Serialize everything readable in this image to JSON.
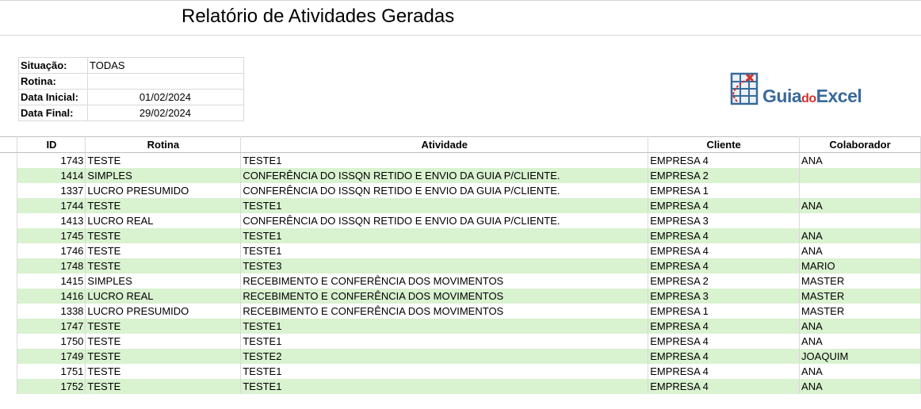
{
  "title": "Relatório de Atividades Geradas",
  "filters": [
    {
      "label": "Situação:",
      "value": "TODAS",
      "align": "left"
    },
    {
      "label": "Rotina:",
      "value": "",
      "align": "left"
    },
    {
      "label": "Data Inicial:",
      "value": "01/02/2024",
      "align": "right"
    },
    {
      "label": "Data Final:",
      "value": "29/02/2024",
      "align": "right"
    }
  ],
  "logo": {
    "part1": "Guia",
    "part2": "do",
    "part3": "Excel",
    "icon": "spreadsheet-logo-icon"
  },
  "table": {
    "headers": [
      "ID",
      "Rotina",
      "Atividade",
      "Cliente",
      "Colaborador"
    ],
    "rows": [
      [
        "1743",
        "TESTE",
        "TESTE1",
        "EMPRESA 4",
        "ANA"
      ],
      [
        "1414",
        "SIMPLES",
        "CONFERÊNCIA DO ISSQN RETIDO E ENVIO DA GUIA P/CLIENTE.",
        "EMPRESA 2",
        ""
      ],
      [
        "1337",
        "LUCRO PRESUMIDO",
        "CONFERÊNCIA DO ISSQN RETIDO E ENVIO DA GUIA P/CLIENTE.",
        "EMPRESA 1",
        ""
      ],
      [
        "1744",
        "TESTE",
        "TESTE1",
        "EMPRESA 4",
        "ANA"
      ],
      [
        "1413",
        "LUCRO REAL",
        "CONFERÊNCIA DO ISSQN RETIDO E ENVIO DA GUIA P/CLIENTE.",
        "EMPRESA 3",
        ""
      ],
      [
        "1745",
        "TESTE",
        "TESTE1",
        "EMPRESA 4",
        "ANA"
      ],
      [
        "1746",
        "TESTE",
        "TESTE1",
        "EMPRESA 4",
        "ANA"
      ],
      [
        "1748",
        "TESTE",
        "TESTE3",
        "EMPRESA 4",
        "MARIO"
      ],
      [
        "1415",
        "SIMPLES",
        "RECEBIMENTO E CONFERÊNCIA DOS MOVIMENTOS",
        "EMPRESA 2",
        "MASTER"
      ],
      [
        "1416",
        "LUCRO REAL",
        "RECEBIMENTO E CONFERÊNCIA DOS MOVIMENTOS",
        "EMPRESA 3",
        "MASTER"
      ],
      [
        "1338",
        "LUCRO PRESUMIDO",
        "RECEBIMENTO E CONFERÊNCIA DOS MOVIMENTOS",
        "EMPRESA 1",
        "MASTER"
      ],
      [
        "1747",
        "TESTE",
        "TESTE1",
        "EMPRESA 4",
        "ANA"
      ],
      [
        "1750",
        "TESTE",
        "TESTE1",
        "EMPRESA 4",
        "ANA"
      ],
      [
        "1749",
        "TESTE",
        "TESTE2",
        "EMPRESA 4",
        "JOAQUIM"
      ],
      [
        "1751",
        "TESTE",
        "TESTE1",
        "EMPRESA 4",
        "ANA"
      ],
      [
        "1752",
        "TESTE",
        "TESTE1",
        "EMPRESA 4",
        "ANA"
      ]
    ]
  },
  "colors": {
    "band": "#d9f2d0",
    "logo_blue": "#3a6a9a",
    "logo_red": "#d2322d"
  }
}
